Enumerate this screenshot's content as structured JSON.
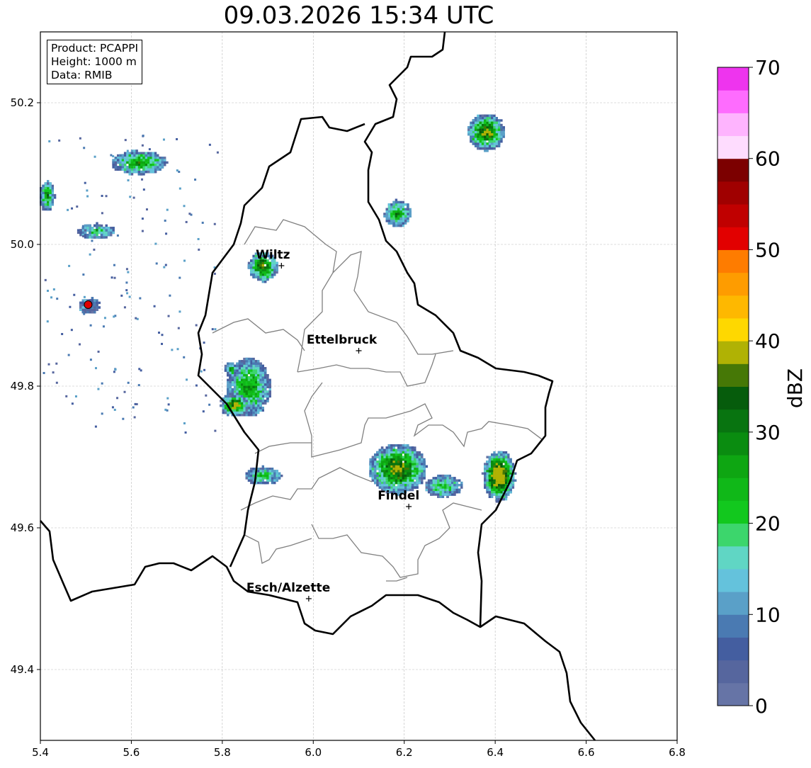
{
  "title": "09.03.2026 15:34 UTC",
  "info_box": {
    "line1": "Product: PCAPPI",
    "line2": "Height: 1000 m",
    "line3": "Data: RMIB"
  },
  "map_extent": {
    "lon": [
      5.4,
      6.8
    ],
    "lat": [
      49.3,
      50.3
    ]
  },
  "x_ticks": [
    "5.4",
    "5.6",
    "5.8",
    "6.0",
    "6.2",
    "6.4",
    "6.6",
    "6.8"
  ],
  "y_ticks": [
    "49.4",
    "49.6",
    "49.8",
    "50.0",
    "50.2"
  ],
  "grid": true,
  "cities": [
    {
      "name": "Wiltz",
      "lon": 5.93,
      "lat": 49.97
    },
    {
      "name": "Ettelbruck",
      "lon": 6.1,
      "lat": 49.85
    },
    {
      "name": "Findel",
      "lon": 6.21,
      "lat": 49.63
    },
    {
      "name": "Esch/Alzette",
      "lon": 5.99,
      "lat": 49.5
    }
  ],
  "radar_site": {
    "lon": 5.505,
    "lat": 49.915,
    "color": "#e00000"
  },
  "colorbar": {
    "label": "dBZ",
    "min": 0,
    "max": 70,
    "ticks": [
      "0",
      "10",
      "20",
      "30",
      "40",
      "50",
      "60",
      "70"
    ],
    "colors": [
      "#6674a6",
      "#56669e",
      "#445ea0",
      "#4a7ab2",
      "#5aa0c8",
      "#64c2dc",
      "#60d6c4",
      "#3cd66c",
      "#12c81e",
      "#10b818",
      "#0ea612",
      "#0a8c10",
      "#087410",
      "#065c0c",
      "#467806",
      "#b0b204",
      "#fed800",
      "#feb800",
      "#fe9c00",
      "#fe7c00",
      "#e20000",
      "#c00000",
      "#a00000",
      "#7c0000",
      "#fedcfe",
      "#feb4fe",
      "#fe6cfe",
      "#ee34ee"
    ]
  }
}
